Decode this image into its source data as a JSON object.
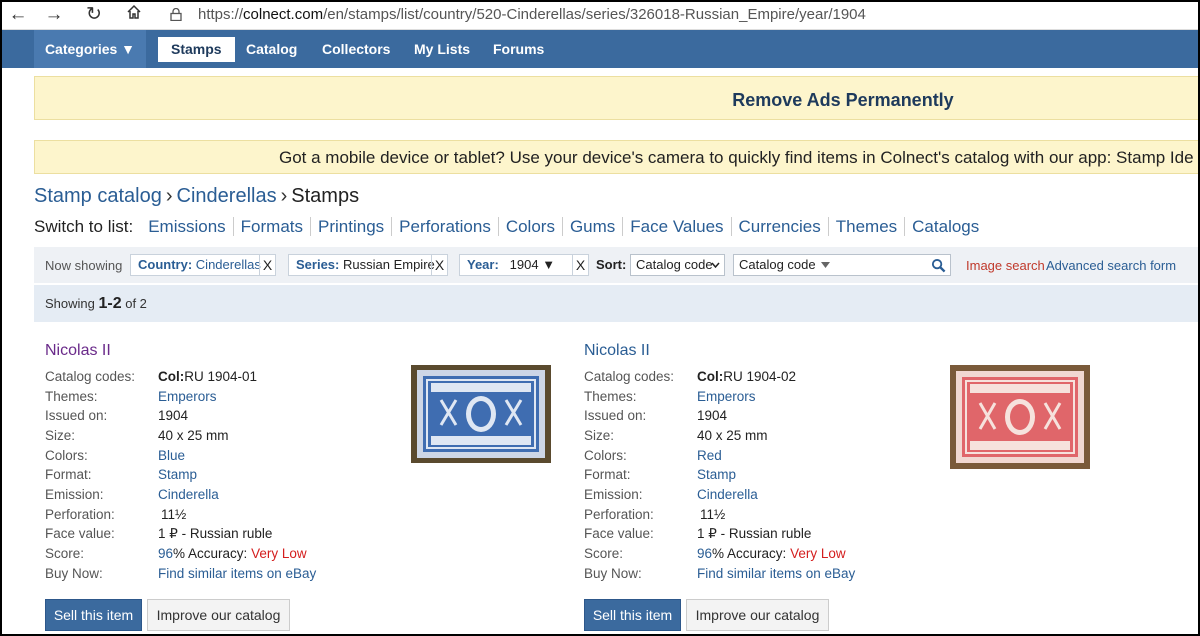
{
  "browser": {
    "url_prefix": "https://",
    "url_host": "colnect.com",
    "url_path": "/en/stamps/list/country/520-Cinderellas/series/326018-Russian_Empire/year/1904"
  },
  "nav": {
    "categories": "Categories ▼",
    "items": [
      "Stamps",
      "Catalog",
      "Collectors",
      "My Lists",
      "Forums"
    ]
  },
  "banners": {
    "remove_ads": "Remove Ads Permanently",
    "mobile": "Got a mobile device or tablet? Use your device's camera to quickly find items in Colnect's catalog with our app: Stamp Ide"
  },
  "breadcrumb": {
    "root": "Stamp catalog",
    "sep": "›",
    "section": "Cinderellas",
    "current": "Stamps"
  },
  "switch_list": {
    "label": "Switch to list:",
    "options": [
      "Emissions",
      "Formats",
      "Printings",
      "Perforations",
      "Colors",
      "Gums",
      "Face Values",
      "Currencies",
      "Themes",
      "Catalogs"
    ]
  },
  "filters": {
    "now_showing": "Now showing",
    "country_key": "Country:",
    "country_val": "Cinderellas",
    "series_key": "Series:",
    "series_val": "Russian Empire",
    "year_key": "Year:",
    "year_val": "1904 ▼",
    "remove": "X",
    "sort_label": "Sort:",
    "sort_value": "Catalog code",
    "search_field": "Catalog code",
    "image_search": "Image search",
    "advanced_search": "Advanced search form"
  },
  "showing": {
    "prefix": "Showing ",
    "range": "1-2",
    "suffix": " of 2"
  },
  "labels": {
    "catalog_codes": "Catalog codes:",
    "themes": "Themes:",
    "issued_on": "Issued on:",
    "size": "Size:",
    "colors": "Colors:",
    "format": "Format:",
    "emission": "Emission:",
    "perforation": "Perforation:",
    "face_value": "Face value:",
    "score": "Score:",
    "buy_now": "Buy Now:",
    "accuracy": "% Accuracy: ",
    "sell": "Sell this item",
    "improve": "Improve our catalog"
  },
  "items": [
    {
      "title": "Nicolas II",
      "code_prefix": "Col:",
      "code": "RU 1904-01",
      "theme": "Emperors",
      "issued": "1904",
      "size": "40 x 25 mm",
      "color": "Blue",
      "format": "Stamp",
      "emission": "Cinderella",
      "perforation": "11½",
      "face_value": "1 ₽ - Russian ruble",
      "score": "96",
      "accuracy": "Very Low",
      "buy": "Find similar items on eBay",
      "stamp_color": "#3f6db1"
    },
    {
      "title": "Nicolas II",
      "code_prefix": "Col:",
      "code": "RU 1904-02",
      "theme": "Emperors",
      "issued": "1904",
      "size": "40 x 25 mm",
      "color": "Red",
      "format": "Stamp",
      "emission": "Cinderella",
      "perforation": "11½",
      "face_value": "1 ₽ - Russian ruble",
      "score": "96",
      "accuracy": "Very Low",
      "buy": "Find similar items on eBay",
      "stamp_color": "#e0666a"
    }
  ]
}
